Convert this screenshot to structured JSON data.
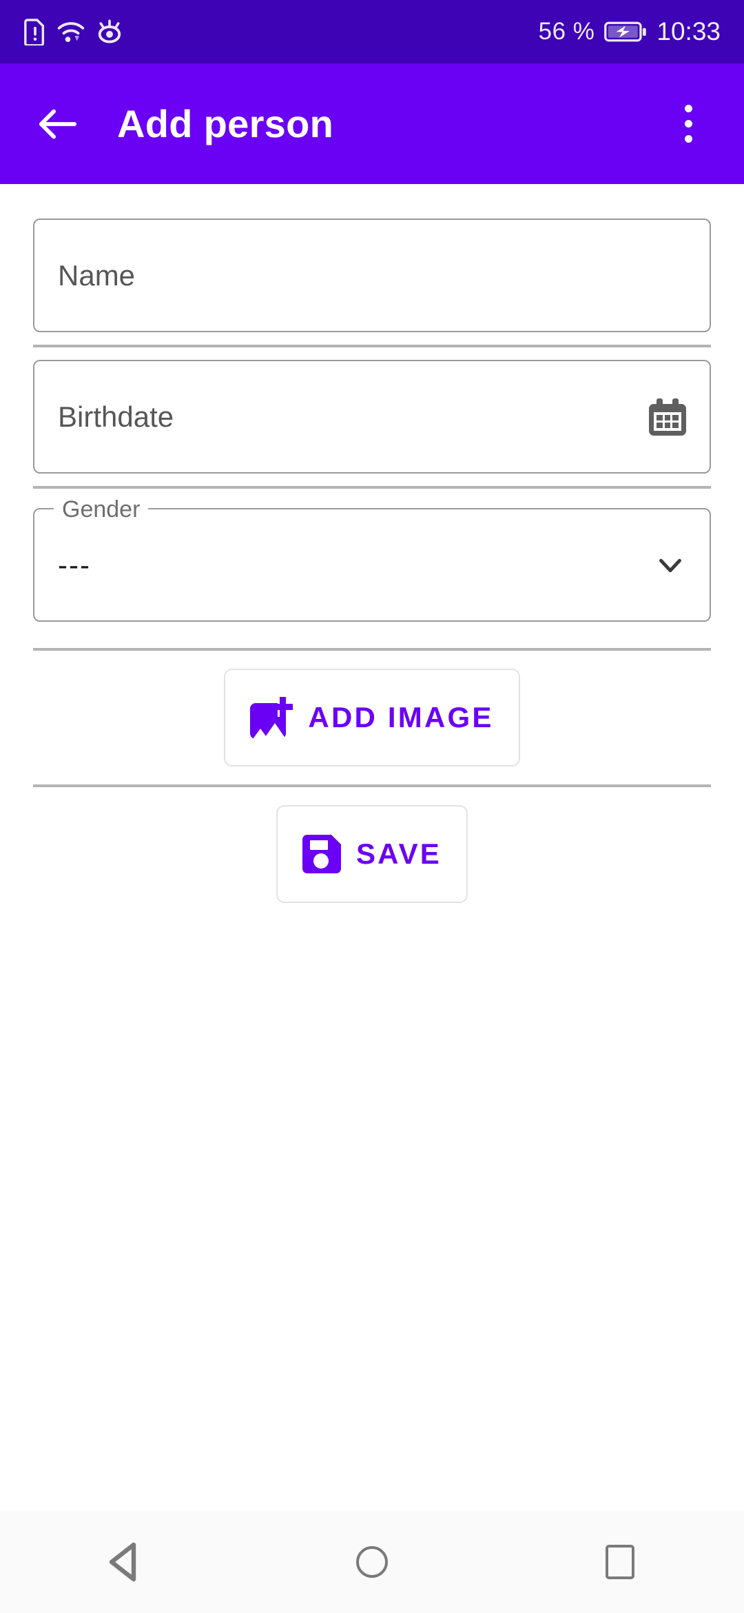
{
  "statusbar": {
    "icons_left": [
      "sim-warning-icon",
      "wifi-icon",
      "eye-comfort-icon"
    ],
    "battery_percent": "56 %",
    "battery_icon": "battery-charging-icon",
    "time": "10:33",
    "background_color": "#3d03b5"
  },
  "appbar": {
    "back_icon": "arrow-left-icon",
    "title": "Add person",
    "overflow_icon": "more-vertical-icon",
    "background_color": "#6a00f4",
    "title_color": "#ffffff"
  },
  "form": {
    "name_field": {
      "placeholder": "Name",
      "value": ""
    },
    "birthdate_field": {
      "placeholder": "Birthdate",
      "value": "",
      "trailing_icon": "calendar-icon"
    },
    "gender_field": {
      "label": "Gender",
      "value": "---",
      "trailing_icon": "chevron-down-icon"
    }
  },
  "buttons": {
    "add_image": {
      "label": "ADD IMAGE",
      "icon": "add-image-icon",
      "color": "#6a00f4"
    },
    "save": {
      "label": "SAVE",
      "icon": "save-floppy-icon",
      "color": "#6a00f4"
    }
  },
  "navbar": {
    "back": "back-triangle-icon",
    "home": "home-circle-icon",
    "recents": "recents-square-icon"
  }
}
